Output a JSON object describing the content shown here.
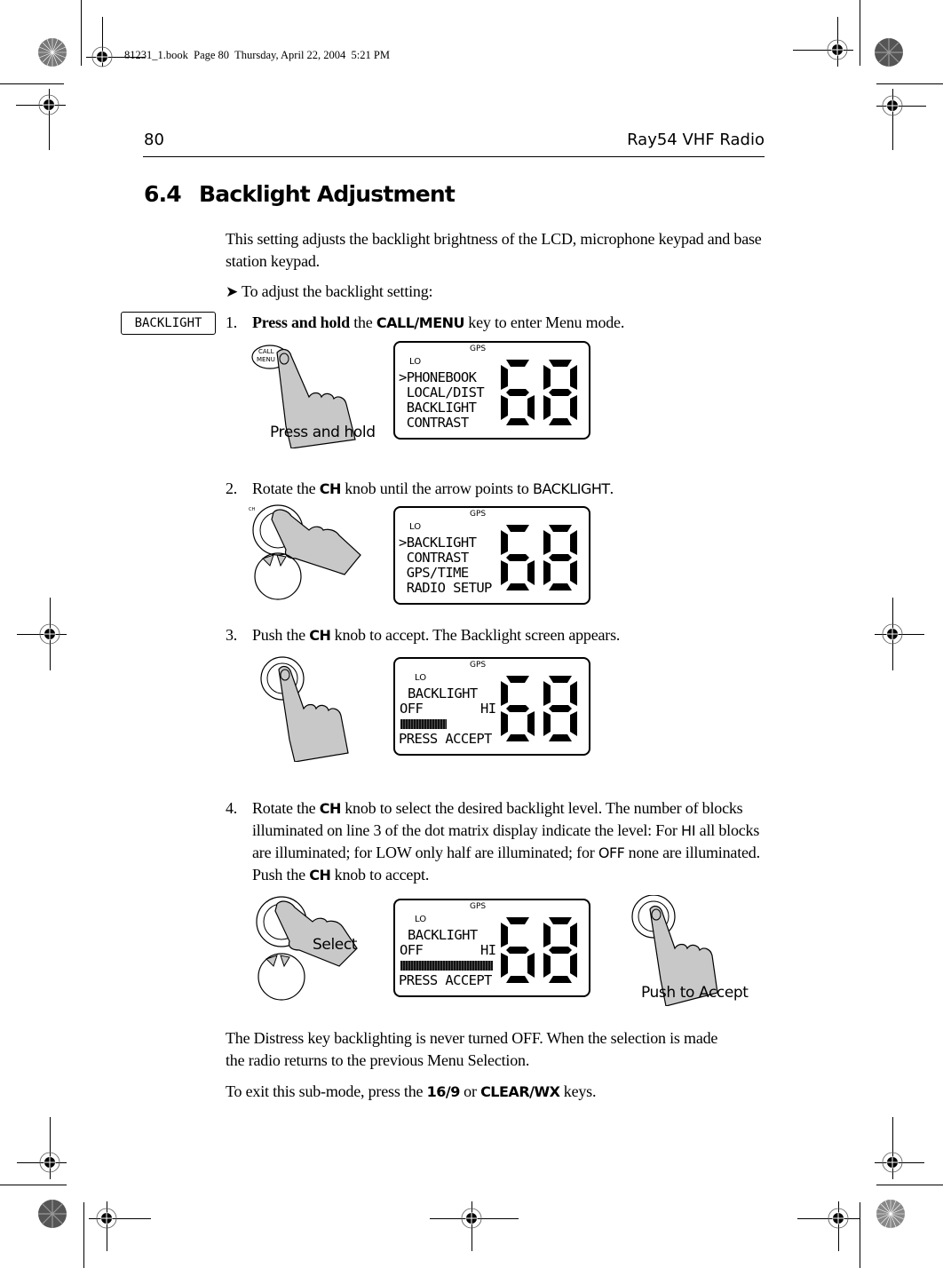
{
  "print_slug": "81231_1.book  Page 80  Thursday, April 22, 2004  5:21 PM",
  "header": {
    "page_number": "80",
    "running_title": "Ray54 VHF Radio"
  },
  "section": {
    "number": "6.4",
    "title": "Backlight Adjustment"
  },
  "intro": "This setting adjusts the backlight brightness of the LCD, microphone keypad and base station keypad.",
  "procedure_lead": "To adjust the backlight setting:",
  "side_tag": "BACKLIGHT",
  "steps": [
    {
      "n": "1.",
      "pre_bold": "Press and hold",
      "mid": " the ",
      "key": "CALL/MENU",
      "post": " key to enter Menu mode."
    },
    {
      "n": "2.",
      "pre": "Rotate the ",
      "key": "CH",
      "post": " knob until the arrow points to ",
      "sans_word": "BACKLIGHT",
      "end": "."
    },
    {
      "n": "3.",
      "pre": "Push the ",
      "key": "CH",
      "post": " knob to accept. The Backlight screen appears."
    },
    {
      "n": "4.",
      "line1_pre": "Rotate the ",
      "key": "CH",
      "line1_post": " knob to select the desired backlight level. The number of blocks illuminated on line 3 of the dot matrix display indicate the level: For ",
      "hi_word": "HI",
      "mid": " all blocks are illuminated; for LOW only half are illuminated; for ",
      "off_word": "OFF",
      "tail": " none are illuminated. Push the ",
      "key2": "CH",
      "end": " knob to accept."
    }
  ],
  "figures": {
    "fig1": {
      "caption": "Press and hold",
      "key_label_top": "CALL",
      "key_label_bottom": "MENU",
      "lcd": {
        "gps": "GPS",
        "lo": "LO",
        "lines": [
          ">PHONEBOOK",
          " LOCAL/DIST",
          " BACKLIGHT",
          " CONTRAST"
        ],
        "channel": "68"
      }
    },
    "fig2": {
      "lcd": {
        "gps": "GPS",
        "lo": "LO",
        "lines": [
          ">BACKLIGHT",
          " CONTRAST",
          " GPS/TIME",
          " RADIO SETUP"
        ],
        "channel": "68"
      }
    },
    "fig3": {
      "lcd": {
        "gps": "GPS",
        "lo": "LO",
        "title": "BACKLIGHT",
        "off": "OFF",
        "hi": "HI",
        "level_fraction": 0.5,
        "footer": "PRESS ACCEPT",
        "channel": "68"
      }
    },
    "fig4": {
      "caption_select": "Select",
      "caption_accept": "Push to Accept",
      "lcd": {
        "gps": "GPS",
        "lo": "LO",
        "title": "BACKLIGHT",
        "off": "OFF",
        "hi": "HI",
        "level_fraction": 1.0,
        "footer": "PRESS ACCEPT",
        "channel": "68"
      }
    }
  },
  "note": "The Distress key backlighting is never turned OFF. When the selection is made the radio returns to the previous Menu Selection.",
  "exit": {
    "pre": "To exit this sub-mode, press the ",
    "key1": "16/9",
    "mid": " or ",
    "key2": "CLEAR/WX",
    "post": " keys."
  }
}
